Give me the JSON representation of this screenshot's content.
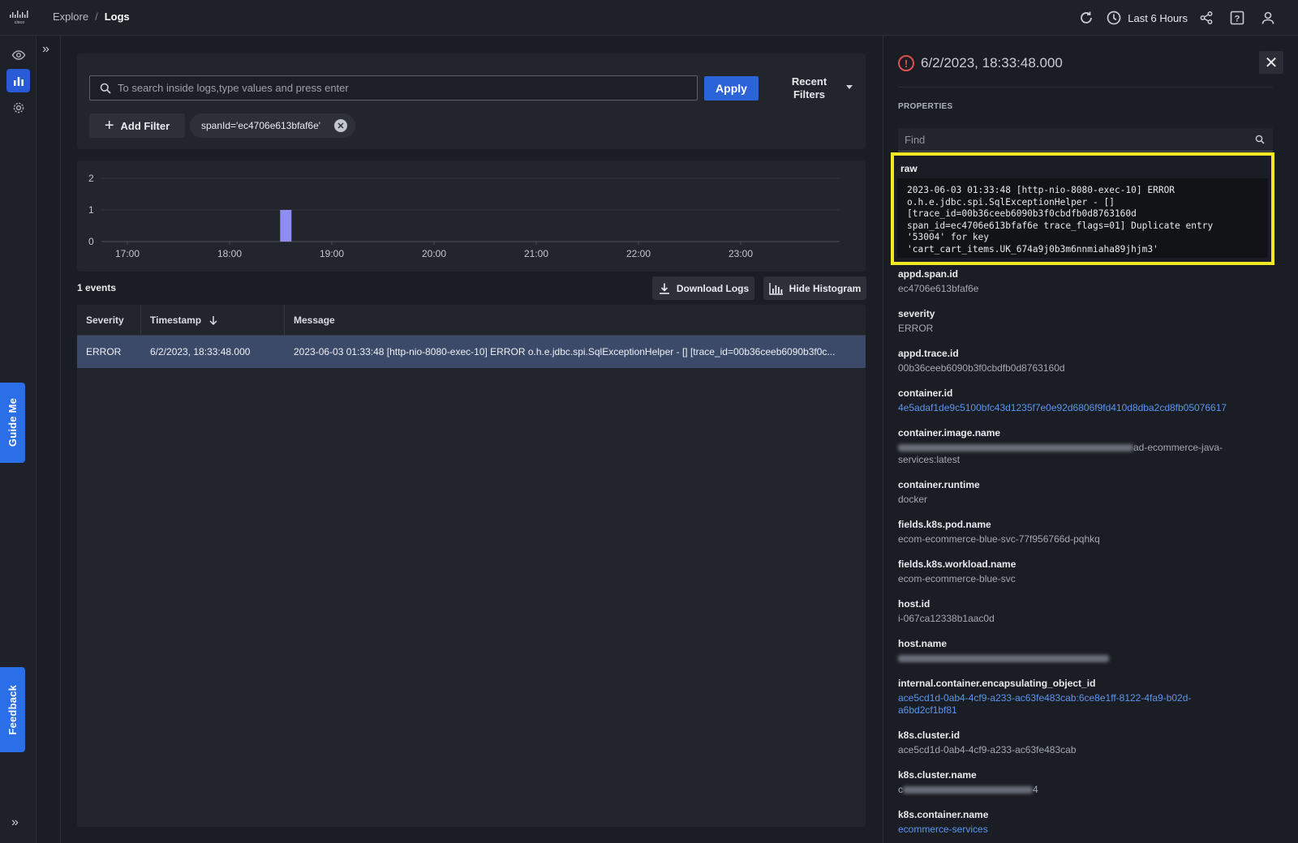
{
  "breadcrumb": {
    "parent": "Explore",
    "separator": "/",
    "current": "Logs"
  },
  "toolbar": {
    "time_range": "Last 6 Hours"
  },
  "rail": {
    "guide_me": "Guide Me",
    "feedback": "Feedback"
  },
  "search": {
    "placeholder": "To search inside logs,type values and press enter",
    "apply": "Apply",
    "recent_filters": "Recent Filters"
  },
  "filters": {
    "add_filter": "Add Filter",
    "chips": [
      "spanId='ec4706e613bfaf6e'"
    ]
  },
  "chart_data": {
    "type": "bar",
    "x_ticks": [
      "17:00",
      "18:00",
      "19:00",
      "20:00",
      "21:00",
      "22:00",
      "23:00"
    ],
    "y_ticks": [
      "0",
      "1",
      "2"
    ],
    "ylim": [
      0,
      2
    ],
    "bars": [
      {
        "time": "18:33",
        "value": 1
      }
    ],
    "bar_color": "#8f8cf2",
    "grid": true
  },
  "events": {
    "count_label": "1 events",
    "download": "Download Logs",
    "hide_histogram": "Hide Histogram"
  },
  "table": {
    "headers": {
      "severity": "Severity",
      "timestamp": "Timestamp",
      "message": "Message"
    },
    "rows": [
      {
        "severity": "ERROR",
        "timestamp": "6/2/2023, 18:33:48.000",
        "message": "2023-06-03 01:33:48 [http-nio-8080-exec-10] ERROR o.h.e.jdbc.spi.SqlExceptionHelper - [] [trace_id=00b36ceeb6090b3f0c..."
      }
    ]
  },
  "detail": {
    "title": "6/2/2023, 18:33:48.000",
    "properties_label": "PROPERTIES",
    "find_placeholder": "Find",
    "raw_label": "raw",
    "raw_lines": [
      "2023-06-03 01:33:48 [http-nio-8080-exec-10] ERROR",
      "o.h.e.jdbc.spi.SqlExceptionHelper - []",
      "[trace_id=00b36ceeb6090b3f0cbdfb0d8763160d",
      "span_id=ec4706e613bfaf6e trace_flags=01] Duplicate entry",
      "'53004' for key",
      "'cart_cart_items.UK_674a9j0b3m6nnmiaha89jhjm3'"
    ],
    "props": [
      {
        "key": "appd.span.id",
        "value": "ec4706e613bfaf6e"
      },
      {
        "key": "severity",
        "value": "ERROR"
      },
      {
        "key": "appd.trace.id",
        "value": "00b36ceeb6090b3f0cbdfb0d8763160d"
      },
      {
        "key": "container.id",
        "value": "4e5adaf1de9c5100bfc43d1235f7e0e92d6806f9fd410d8dba2cd8fb05076617"
      },
      {
        "key": "container.image.name",
        "value_suffix": "ad-ecommerce-java-",
        "value_line2": "services:latest"
      },
      {
        "key": "container.runtime",
        "value": "docker"
      },
      {
        "key": "fields.k8s.pod.name",
        "value": "ecom-ecommerce-blue-svc-77f956766d-pqhkq"
      },
      {
        "key": "fields.k8s.workload.name",
        "value": "ecom-ecommerce-blue-svc"
      },
      {
        "key": "host.id",
        "value": "i-067ca12338b1aac0d"
      },
      {
        "key": "host.name"
      },
      {
        "key": "internal.container.encapsulating_object_id",
        "value": "ace5cd1d-0ab4-4cf9-a233-ac63fe483cab:6ce8e1ff-8122-4fa9-b02d-",
        "value_line2": "a6bd2cf1bf81"
      },
      {
        "key": "k8s.cluster.id",
        "value": "ace5cd1d-0ab4-4cf9-a233-ac63fe483cab"
      },
      {
        "key": "k8s.cluster.name",
        "value_prefix": "c",
        "value_suffix": "4"
      },
      {
        "key": "k8s.container.name",
        "value": "ecommerce-services"
      }
    ]
  }
}
